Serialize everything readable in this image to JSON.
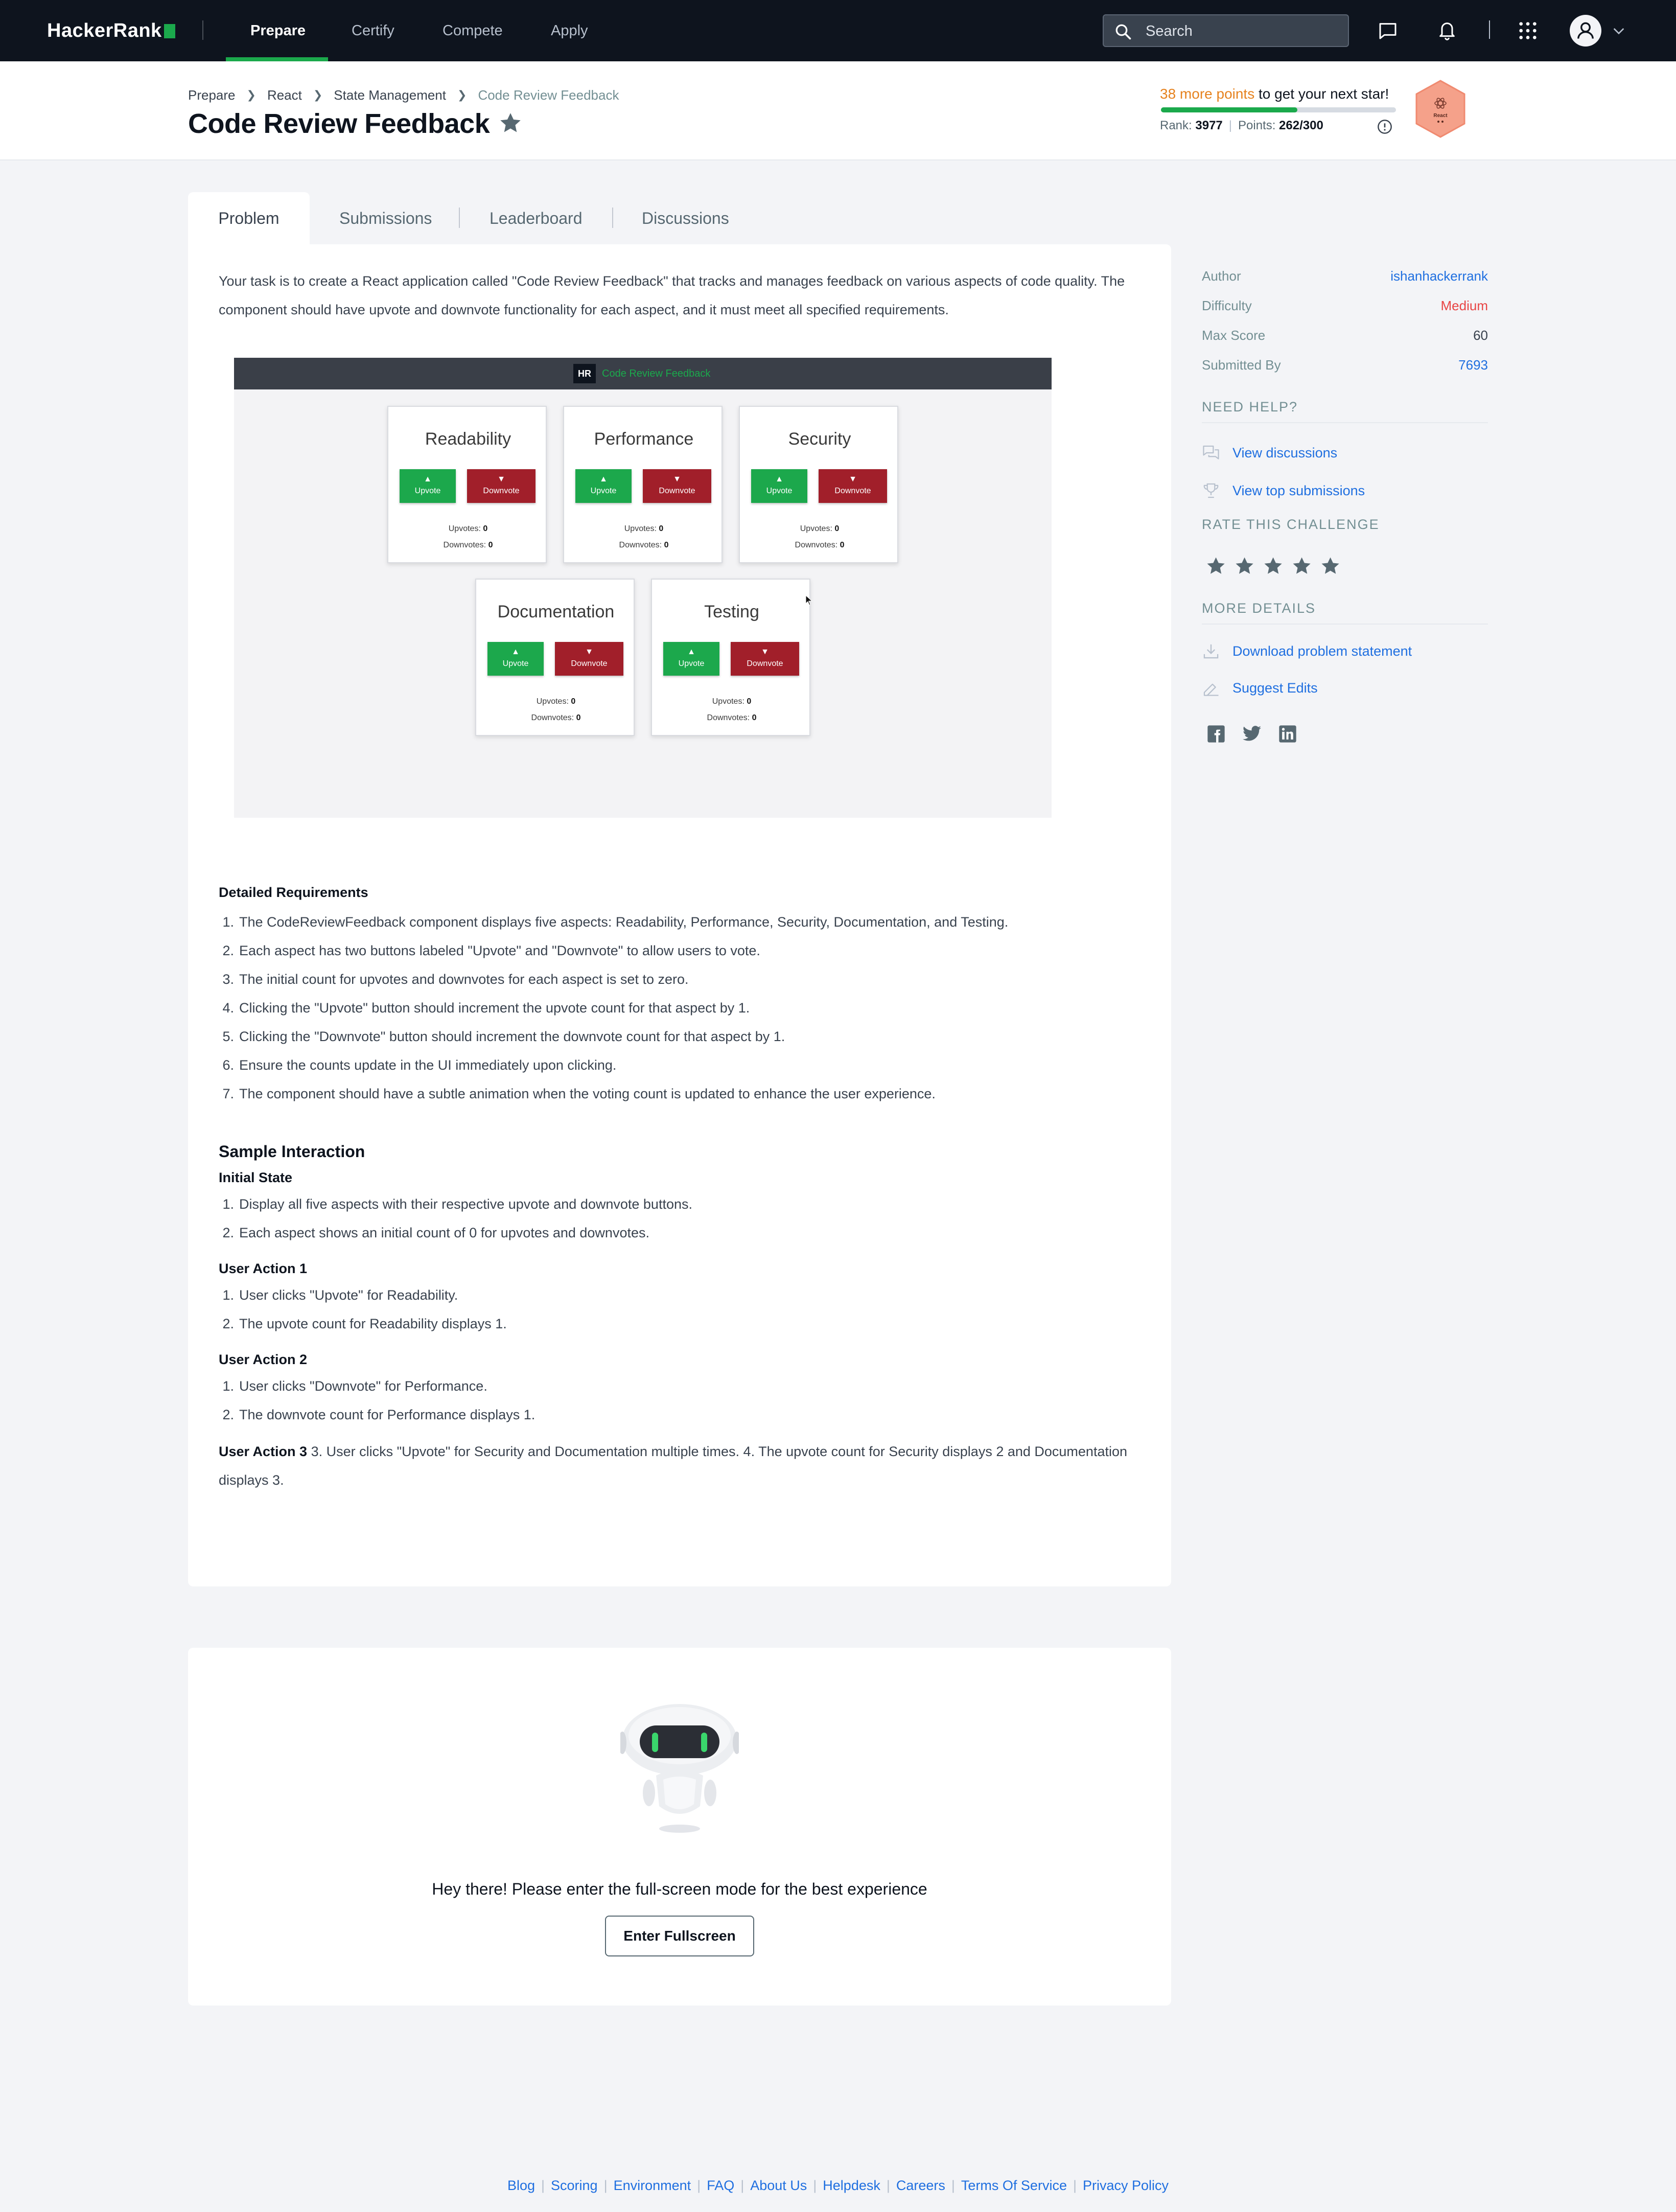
{
  "topnav": {
    "logo": "HackerRank",
    "items": [
      {
        "label": "Prepare",
        "active": true
      },
      {
        "label": "Certify"
      },
      {
        "label": "Compete"
      },
      {
        "label": "Apply"
      }
    ],
    "search": {
      "placeholder": "Search"
    }
  },
  "header": {
    "breadcrumbs": [
      "Prepare",
      "React",
      "State Management",
      "Code Review Feedback"
    ],
    "title": "Code Review Feedback",
    "points_highlight": "38 more points",
    "points_rest": " to get your next star!",
    "rank_label": "Rank:",
    "rank_value": "3977",
    "points_label": "Points:",
    "points_value": "262/300",
    "progress_fraction": 0.58,
    "badge_label": "React",
    "accent_color": "#1ba94c",
    "highlight_color": "#e6821e"
  },
  "tabs": [
    {
      "label": "Problem",
      "active": true
    },
    {
      "label": "Submissions"
    },
    {
      "label": "Leaderboard"
    },
    {
      "label": "Discussions"
    }
  ],
  "problem": {
    "intro": "Your task is to create a React application called \"Code Review Feedback\" that tracks and manages feedback on various aspects of code quality. The component should have upvote and downvote functionality for each aspect, and it must meet all specified requirements.",
    "screenshot": {
      "logo": "HR",
      "title": "Code Review Feedback",
      "upvote_label": "Upvote",
      "downvote_label": "Downvote",
      "upvotes_label": "Upvotes:",
      "downvotes_label": "Downvotes:",
      "aspects": [
        {
          "name": "Readability",
          "upvotes": "0",
          "downvotes": "0"
        },
        {
          "name": "Performance",
          "upvotes": "0",
          "downvotes": "0"
        },
        {
          "name": "Security",
          "upvotes": "0",
          "downvotes": "0"
        },
        {
          "name": "Documentation",
          "upvotes": "0",
          "downvotes": "0"
        },
        {
          "name": "Testing",
          "upvotes": "0",
          "downvotes": "0"
        }
      ]
    },
    "requirements_title": "Detailed Requirements",
    "requirements": [
      "The CodeReviewFeedback component displays five aspects: Readability, Performance, Security, Documentation, and Testing.",
      "Each aspect has two buttons labeled \"Upvote\" and \"Downvote\" to allow users to vote.",
      "The initial count for upvotes and downvotes for each aspect is set to zero.",
      "Clicking the \"Upvote\" button should increment the upvote count for that aspect by 1.",
      "Clicking the \"Downvote\" button should increment the downvote count for that aspect by 1.",
      "Ensure the counts update in the UI immediately upon clicking.",
      "The component should have a subtle animation when the voting count is updated to enhance the user experience."
    ],
    "sample_title": "Sample Interaction",
    "initial_state_title": "Initial State",
    "initial_state": [
      "Display all five aspects with their respective upvote and downvote buttons.",
      "Each aspect shows an initial count of 0 for upvotes and downvotes."
    ],
    "action1_title": "User Action 1",
    "action1": [
      "User clicks \"Upvote\" for Readability.",
      "The upvote count for Readability displays 1."
    ],
    "action2_title": "User Action 2",
    "action2": [
      "User clicks \"Downvote\" for Performance.",
      "The downvote count for Performance displays 1."
    ],
    "action3_title": "User Action 3",
    "action3_text": " 3. User clicks \"Upvote\" for Security and Documentation multiple times. 4. The upvote count for Security displays 2 and Documentation displays 3."
  },
  "fullscreen": {
    "message": "Hey there! Please enter the full-screen mode for the best experience",
    "button_label": "Enter Fullscreen"
  },
  "sidebar": {
    "details": [
      {
        "label": "Author",
        "value": "ishanhackerrank",
        "kind": "link"
      },
      {
        "label": "Difficulty",
        "value": "Medium",
        "kind": "medium"
      },
      {
        "label": "Max Score",
        "value": "60",
        "kind": "plain"
      },
      {
        "label": "Submitted By",
        "value": "7693",
        "kind": "link"
      }
    ],
    "need_help_title": "NEED HELP?",
    "view_discussions": "View discussions",
    "view_top_submissions": "View top submissions",
    "rate_title": "RATE THIS CHALLENGE",
    "rating_stars": 5,
    "more_details_title": "MORE DETAILS",
    "download_label": "Download problem statement",
    "suggest_label": "Suggest Edits",
    "social": [
      "facebook-icon",
      "twitter-icon",
      "linkedin-icon"
    ]
  },
  "footer": {
    "links": [
      "Blog",
      "Scoring",
      "Environment",
      "FAQ",
      "About Us",
      "Helpdesk",
      "Careers",
      "Terms Of Service",
      "Privacy Policy"
    ]
  }
}
